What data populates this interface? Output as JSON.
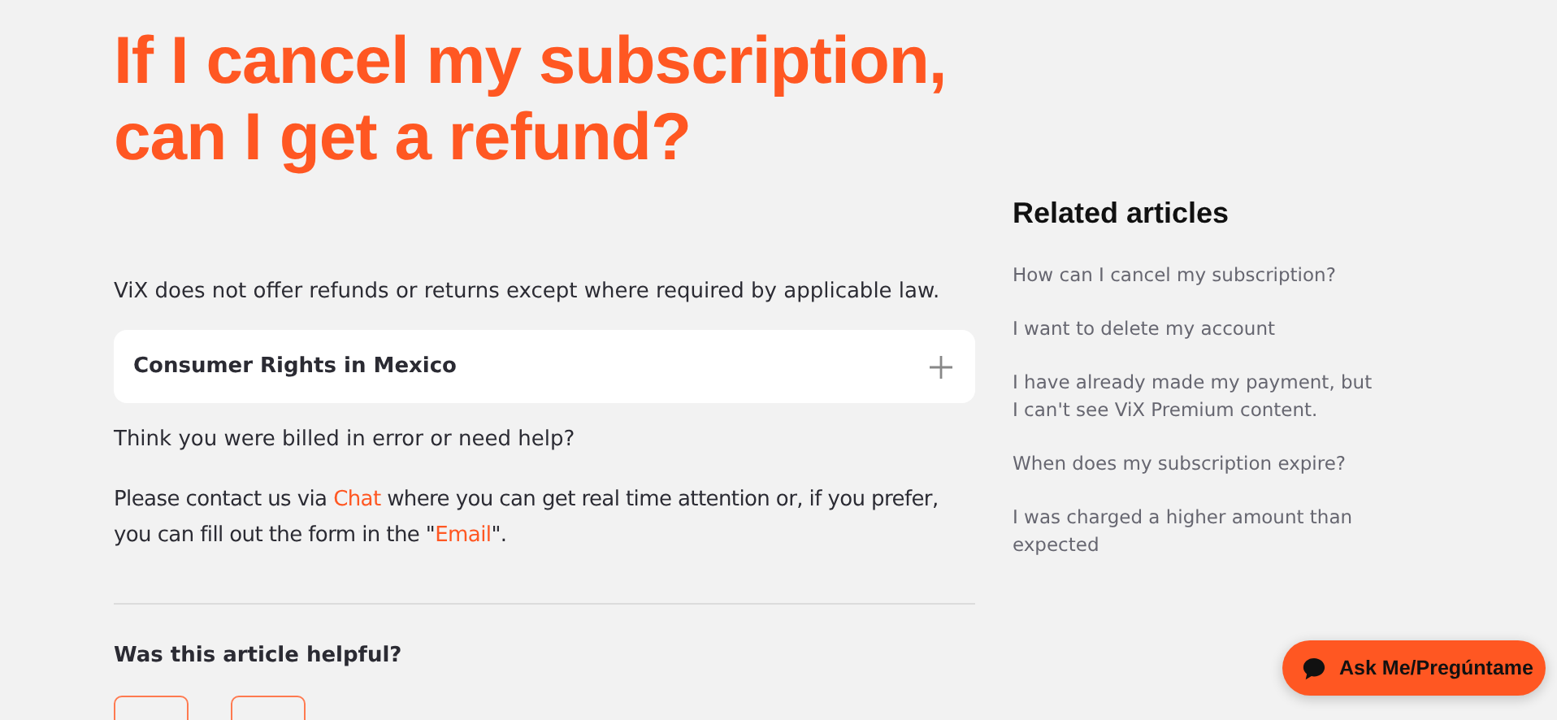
{
  "title": "If I cancel my subscription, can I get a refund?",
  "intro": "ViX does not offer refunds or returns except where required by applicable law.",
  "accordion": {
    "label": "Consumer Rights in Mexico",
    "expanded": false
  },
  "help_question": "Think you were billed in error or need help?",
  "contact": [
    {
      "kind": "text",
      "text": "Please contact us via "
    },
    {
      "kind": "link",
      "text": "Chat"
    },
    {
      "kind": "text",
      "text": " where you can get real time attention or, if you prefer, you can fill out the form in the \""
    },
    {
      "kind": "link",
      "text": "Email"
    },
    {
      "kind": "text",
      "text": "\"."
    }
  ],
  "feedback": {
    "question": "Was this article helpful?",
    "buttons": [
      {
        "kind": "outline"
      },
      {
        "kind": "outline"
      }
    ]
  },
  "related": {
    "heading": "Related articles",
    "items": [
      "How can I cancel my subscription?",
      "I want to delete my account",
      "I have already made my payment, but I can't see ViX Premium content.",
      "When does my subscription expire?",
      "I was charged a higher amount than expected"
    ]
  },
  "chat_button": {
    "label": "Ask Me/Pregúntame"
  }
}
